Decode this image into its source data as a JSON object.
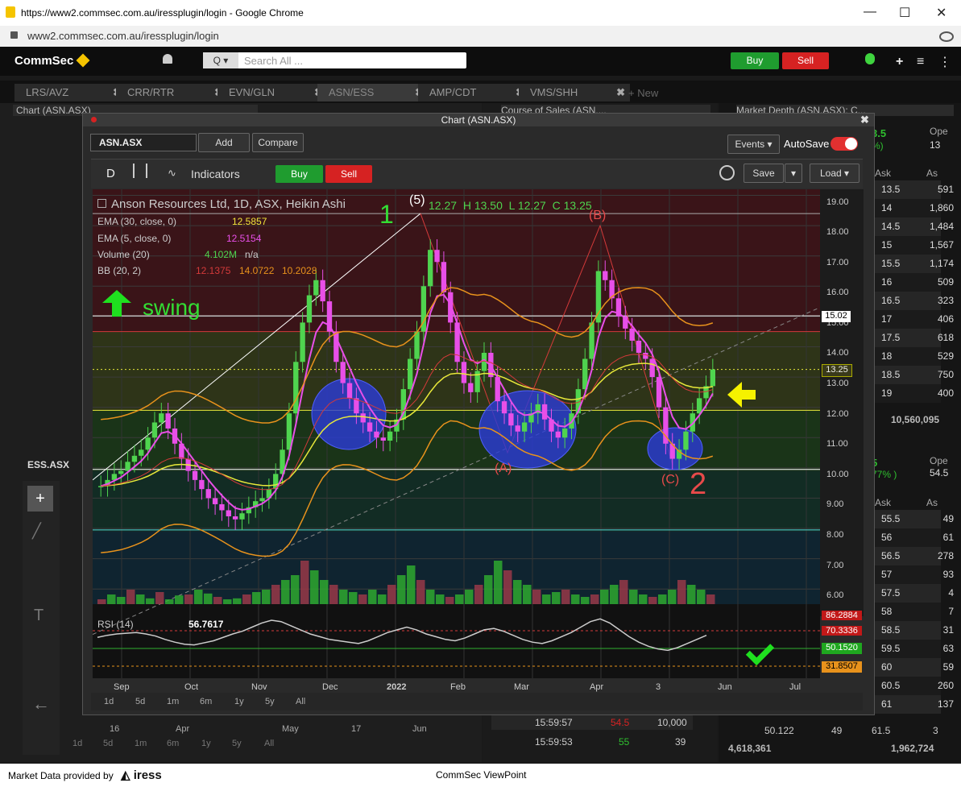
{
  "browser": {
    "title": "https://www2.commsec.com.au/iressplugin/login - Google Chrome",
    "url": "www2.commsec.com.au/iressplugin/login",
    "min": "—",
    "max": "☐",
    "close": "✕"
  },
  "top": {
    "logo": "CommSec",
    "search_prefix": "Q ▾",
    "search_placeholder": "Search All ...",
    "buy": "Buy",
    "sell": "Sell"
  },
  "tabs": [
    {
      "label": "LRS/AVZ"
    },
    {
      "label": "CRR/RTR"
    },
    {
      "label": "EVN/GLN"
    },
    {
      "label": "ASN/ESS"
    },
    {
      "label": "AMP/CDT"
    },
    {
      "label": "VMS/SHH"
    }
  ],
  "new_tab": "+ New",
  "bg": {
    "chart_header": "Chart (ASN.ASX)",
    "cos_header": "Course of Sales (ASN....",
    "md_header": "Market Depth (ASN.ASX): C...",
    "ess": "ESS.ASX",
    "md_top_val": "3.5",
    "md_top_pct": "%)",
    "md_ope": "Ope",
    "md_ope_val": "13",
    "md2_val": "5",
    "md2_pct": "77% )",
    "md2_ope": "Ope",
    "md2_ope_val": "54.5",
    "ask": "Ask",
    "as": "As",
    "total1": "10,560,095",
    "total2a": "4,618,361",
    "total2b": "1,962,724",
    "cos_row1": {
      "time": "15:59:57",
      "price": "54.5",
      "vol": "10,000"
    },
    "cos_row2": {
      "time": "15:59:53",
      "price": "55",
      "vol": "39"
    },
    "cos_last": {
      "a": "50.122",
      "b": "49",
      "c": "61.5",
      "d": "3"
    },
    "bottom_ranges": [
      "1d",
      "5d",
      "1m",
      "6m",
      "1y",
      "5y",
      "All"
    ],
    "bottom_months": [
      "16",
      "Apr",
      "May",
      "17",
      "Jun"
    ]
  },
  "depth1": [
    [
      "13.5",
      "591"
    ],
    [
      "14",
      "1,860"
    ],
    [
      "14.5",
      "1,484"
    ],
    [
      "15",
      "1,567"
    ],
    [
      "15.5",
      "1,174"
    ],
    [
      "16",
      "509"
    ],
    [
      "16.5",
      "323"
    ],
    [
      "17",
      "406"
    ],
    [
      "17.5",
      "618"
    ],
    [
      "18",
      "529"
    ],
    [
      "18.5",
      "750"
    ],
    [
      "19",
      "400"
    ]
  ],
  "depth2": [
    [
      "55.5",
      "49"
    ],
    [
      "56",
      "61"
    ],
    [
      "56.5",
      "278"
    ],
    [
      "57",
      "93"
    ],
    [
      "57.5",
      "4"
    ],
    [
      "58",
      "7"
    ],
    [
      "58.5",
      "31"
    ],
    [
      "59.5",
      "63"
    ],
    [
      "60",
      "59"
    ],
    [
      "60.5",
      "260"
    ],
    [
      "61",
      "137"
    ]
  ],
  "chart_window": {
    "title": "Chart (ASN.ASX)",
    "symbol": "ASN.ASX",
    "add": "Add",
    "compare": "Compare",
    "events": "Events ▾",
    "autosave": "AutoSave",
    "period": "D",
    "indicators": "Indicators",
    "buy": "Buy",
    "sell": "Sell",
    "save": "Save",
    "load": "Load ▾"
  },
  "legend": {
    "title": "Anson Resources Ltd, 1D, ASX, Heikin Ashi",
    "o": "12.27",
    "h": "H 13.50",
    "l": "L 12.27",
    "c": "C 13.25",
    "ema30": "EMA (30, close, 0)",
    "ema30_val": "12.5857",
    "ema5": "EMA (5, close, 0)",
    "ema5_val": "12.5154",
    "vol": "Volume (20)",
    "vol_val": "4.102M",
    "vol_na": "n/a",
    "bb": "BB (20, 2)",
    "bb1": "12.1375",
    "bb2": "14.0722",
    "bb3": "10.2028",
    "rsi": "RSI (14)",
    "rsi_val": "56.7617"
  },
  "annotations": {
    "one": "1",
    "two": "2",
    "five": "(5)",
    "a": "(A)",
    "b": "(B)",
    "c": "(C)",
    "swing": "swing"
  },
  "chart_data": {
    "type": "candlestick",
    "symbol": "ASN.ASX",
    "ylim": [
      5.5,
      19.2
    ],
    "yticks": [
      "19.00",
      "18.00",
      "17.00",
      "16.00",
      "15.00",
      "14.00",
      "13.00",
      "12.00",
      "11.00",
      "10.00",
      "9.00",
      "8.00",
      "7.00",
      "6.00"
    ],
    "xticks": [
      "Sep",
      "Oct",
      "Nov",
      "Dec",
      "2022",
      "Feb",
      "Mar",
      "Apr",
      "3",
      "Jun",
      "Jul"
    ],
    "price_labels": {
      "hline": "15.02",
      "last": "13.25"
    },
    "rsi_labels": [
      "86.2884",
      "70.3336",
      "50.1520",
      "31.8507"
    ],
    "close": [
      9.4,
      9.6,
      9.8,
      9.9,
      10.2,
      10.4,
      10.6,
      11.0,
      11.5,
      11.8,
      11.3,
      10.8,
      10.3,
      9.9,
      9.6,
      9.3,
      9.0,
      8.8,
      8.6,
      8.4,
      8.3,
      8.5,
      8.7,
      8.9,
      9.0,
      9.3,
      9.8,
      10.6,
      11.8,
      13.5,
      14.8,
      15.7,
      16.2,
      15.5,
      14.5,
      13.5,
      12.8,
      12.3,
      11.8,
      11.5,
      11.2,
      11.0,
      10.9,
      11.2,
      11.6,
      12.6,
      13.6,
      14.5,
      16.0,
      17.2,
      16.8,
      15.8,
      14.8,
      13.5,
      12.8,
      12.5,
      13.2,
      13.8,
      13.0,
      12.2,
      11.8,
      11.4,
      11.2,
      11.5,
      11.8,
      12.1,
      11.6,
      11.2,
      11.0,
      11.3,
      11.8,
      12.6,
      13.6,
      14.8,
      16.5,
      16.2,
      15.6,
      15.0,
      14.6,
      14.2,
      13.8,
      13.6,
      13.0,
      12.0,
      10.8,
      10.3,
      10.6,
      11.2,
      11.8,
      12.3,
      12.7,
      13.25
    ],
    "rsi": [
      55,
      58,
      60,
      61,
      62,
      60,
      57,
      52,
      48,
      45,
      44,
      47,
      50,
      55,
      60,
      64,
      70,
      76,
      80,
      78,
      72,
      66,
      60,
      56,
      52,
      50,
      48,
      46,
      50,
      56,
      62,
      66,
      70,
      66,
      60,
      56,
      52,
      50,
      54,
      60,
      66,
      68,
      64,
      58,
      52,
      48,
      46,
      50,
      56,
      62,
      70,
      78,
      82,
      76,
      66,
      56,
      48,
      42,
      38,
      36,
      40,
      46,
      52,
      58
    ],
    "volume": [
      1,
      2,
      1.5,
      3,
      2,
      1.2,
      2.5,
      1,
      1.8,
      2,
      3,
      2.2,
      1.5,
      1,
      1.2,
      2,
      2.5,
      3,
      4,
      5,
      6,
      9,
      7,
      5,
      4,
      3,
      2.5,
      2,
      3,
      2,
      4,
      6,
      8,
      5,
      3,
      2,
      1.5,
      2,
      3,
      4,
      6,
      9,
      7,
      5,
      4,
      3,
      2,
      2.5,
      3,
      2,
      1.5,
      2,
      3,
      4,
      5,
      3,
      2,
      1.5,
      2,
      3,
      5,
      4,
      3,
      2
    ]
  }
}
